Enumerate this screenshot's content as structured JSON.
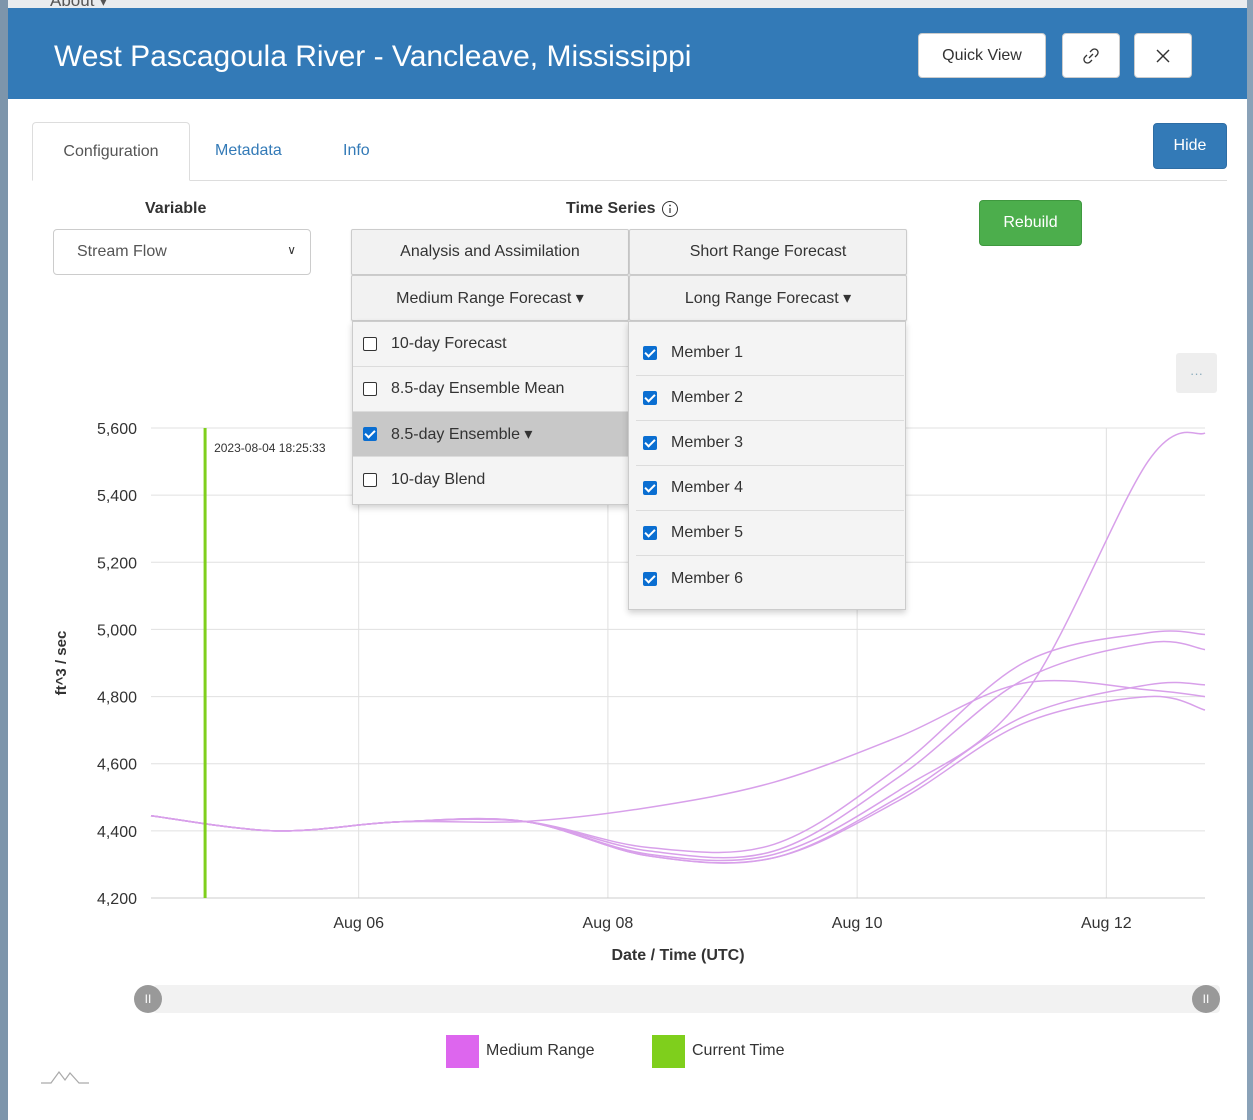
{
  "background": {
    "nav_label": "About ▾"
  },
  "header": {
    "title": "West Pascagoula River - Vancleave, Mississippi",
    "quick_view": "Quick View",
    "link_icon": "link-icon",
    "close_icon": "close-icon",
    "color": "#337ab7"
  },
  "tabs": [
    {
      "label": "Configuration",
      "active": true
    },
    {
      "label": "Metadata",
      "active": false
    },
    {
      "label": "Info",
      "active": false
    }
  ],
  "hide_button": "Hide",
  "variable": {
    "label": "Variable",
    "selected": "Stream Flow"
  },
  "time_series": {
    "label": "Time Series",
    "buttons": {
      "analysis": "Analysis and Assimilation",
      "short": "Short Range Forecast",
      "medium": "Medium Range Forecast ▾",
      "long": "Long Range Forecast ▾"
    }
  },
  "rebuild_button": "Rebuild",
  "medium_menu": [
    {
      "label": "10-day Forecast",
      "checked": false
    },
    {
      "label": "8.5-day Ensemble Mean",
      "checked": false
    },
    {
      "label": "8.5-day Ensemble ▾",
      "checked": true
    },
    {
      "label": "10-day Blend",
      "checked": false
    }
  ],
  "long_menu": [
    {
      "label": "Member 1",
      "checked": true
    },
    {
      "label": "Member 2",
      "checked": true
    },
    {
      "label": "Member 3",
      "checked": true
    },
    {
      "label": "Member 4",
      "checked": true
    },
    {
      "label": "Member 5",
      "checked": true
    },
    {
      "label": "Member 6",
      "checked": true
    }
  ],
  "chart_menu_button": "···",
  "chart_data": {
    "type": "line",
    "title": "",
    "xlabel": "Date / Time (UTC)",
    "ylabel": "ft^3 / sec",
    "ylim": [
      4200,
      5600
    ],
    "yticks": [
      4200,
      4400,
      4600,
      4800,
      5000,
      5200,
      5400,
      5600
    ],
    "ytick_labels": [
      "4,200",
      "4,400",
      "4,600",
      "4,800",
      "5,000",
      "5,200",
      "5,400",
      "5,600"
    ],
    "xlim": [
      "2023-08-04T08:00",
      "2023-08-12T19:00"
    ],
    "xticks": [
      "2023-08-06T00:00",
      "2023-08-08T00:00",
      "2023-08-10T00:00",
      "2023-08-12T00:00"
    ],
    "xtick_labels": [
      "Aug 06",
      "Aug 08",
      "Aug 10",
      "Aug 12"
    ],
    "current_time": "2023-08-04T18:25",
    "current_time_label": "2023-08-04 18:25:33",
    "grid": true,
    "x": [
      "2023-08-04T08:00",
      "2023-08-05T08:00",
      "2023-08-06T08:00",
      "2023-08-07T08:00",
      "2023-08-08T08:00",
      "2023-08-09T08:00",
      "2023-08-10T08:00",
      "2023-08-11T08:00",
      "2023-08-12T08:00",
      "2023-08-12T19:00"
    ],
    "series": [
      {
        "values": [
          4445,
          4400,
          4427,
          4428,
          4470,
          4545,
          4680,
          4840,
          4820,
          4800
        ]
      },
      {
        "values": [
          4445,
          4400,
          4427,
          4428,
          4350,
          4360,
          4590,
          4900,
          4990,
          4985
        ]
      },
      {
        "values": [
          4445,
          4400,
          4427,
          4428,
          4340,
          4340,
          4560,
          4850,
          4960,
          4940
        ]
      },
      {
        "values": [
          4445,
          4400,
          4427,
          4428,
          4330,
          4330,
          4520,
          4800,
          5500,
          5585
        ]
      },
      {
        "values": [
          4445,
          4400,
          4427,
          4428,
          4325,
          4320,
          4490,
          4720,
          4800,
          4760
        ]
      },
      {
        "values": [
          4445,
          4400,
          4427,
          4428,
          4325,
          4320,
          4500,
          4740,
          4835,
          4835
        ]
      }
    ],
    "legend": [
      {
        "label": "Medium Range",
        "color": "#dd66ee"
      },
      {
        "label": "Current Time",
        "color": "#7fcf1c"
      }
    ],
    "legend_position": "bottom"
  },
  "colors": {
    "series": "#d8a0ea",
    "current": "#7fcf1c",
    "primary": "#337ab7",
    "success": "#4cae4c"
  },
  "slider": {
    "left_icon": "slider-handle-left",
    "right_icon": "slider-handle-right"
  },
  "footer_icon": "chart-logo-icon"
}
